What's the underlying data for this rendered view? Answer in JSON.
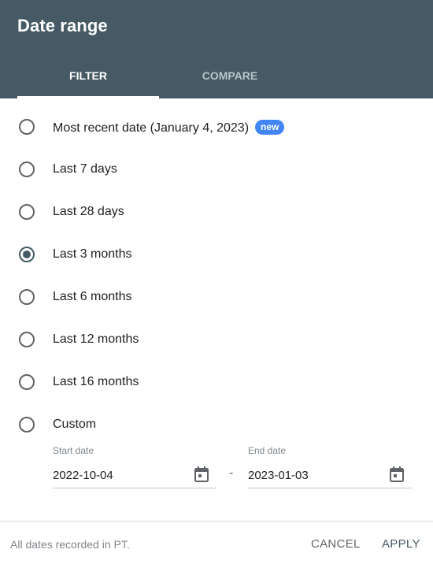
{
  "dialog": {
    "title": "Date range"
  },
  "tabs": [
    {
      "label": "FILTER",
      "active": true
    },
    {
      "label": "COMPARE",
      "active": false
    }
  ],
  "options": [
    {
      "label": "Most recent date (January 4, 2023)",
      "badge": "new",
      "selected": false
    },
    {
      "label": "Last 7 days",
      "selected": false
    },
    {
      "label": "Last 28 days",
      "selected": false
    },
    {
      "label": "Last 3 months",
      "selected": true
    },
    {
      "label": "Last 6 months",
      "selected": false
    },
    {
      "label": "Last 12 months",
      "selected": false
    },
    {
      "label": "Last 16 months",
      "selected": false
    },
    {
      "label": "Custom",
      "selected": false
    }
  ],
  "custom_range": {
    "start_label": "Start date",
    "start_value": "2022-10-04",
    "separator": "-",
    "end_label": "End date",
    "end_value": "2023-01-03",
    "icon": "calendar-icon"
  },
  "footer": {
    "note": "All dates recorded in PT.",
    "cancel_label": "CANCEL",
    "apply_label": "APPLY"
  },
  "colors": {
    "header_bg": "#455a64",
    "badge_bg": "#4285f4",
    "accent": "#455a64"
  }
}
